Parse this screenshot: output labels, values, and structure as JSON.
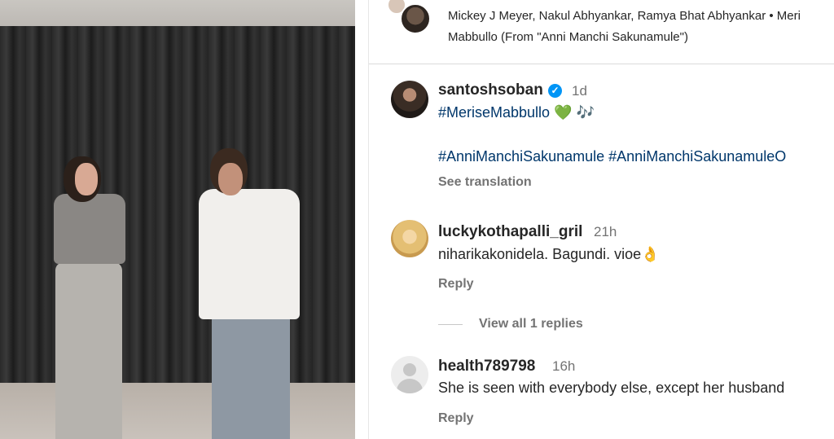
{
  "header": {
    "line1": "Mickey J Meyer, Nakul Abhyankar, Ramya Bhat Abhyankar • Meri",
    "line2": "Mabbullo (From \"Anni Manchi Sakunamule\")"
  },
  "caption": {
    "username": "santoshsoban",
    "time": "1d",
    "hashtag1": "#MeriseMabbullo",
    "emoji1": "💚",
    "emoji2": "🎶",
    "hashtag2": "#AnniManchiSakunamule",
    "hashtag3": "#AnniManchiSakunamuleO",
    "see_translation": "See translation"
  },
  "comments": [
    {
      "username": "luckykothapalli_gril",
      "time": "21h",
      "text": "niharikakonidela. Bagundi. vioe👌",
      "reply": "Reply",
      "view_replies": "View all 1 replies"
    },
    {
      "username": "health789798",
      "time": "16h",
      "text": "She is seen with everybody else, except her husband",
      "reply": "Reply"
    }
  ]
}
